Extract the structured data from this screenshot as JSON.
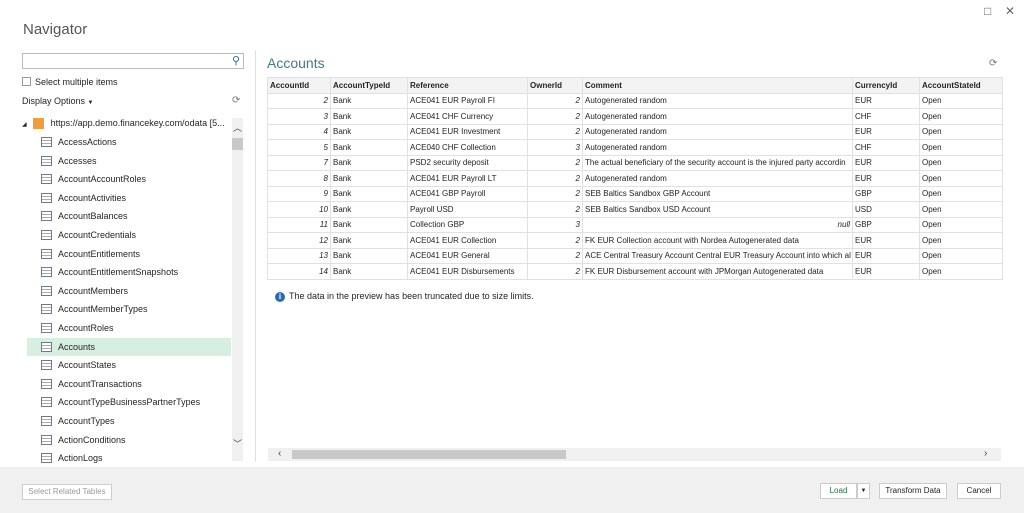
{
  "window": {
    "title": "Navigator",
    "maximize_icon": "□",
    "close_icon": "✕"
  },
  "left": {
    "search_placeholder": "",
    "select_multiple": "Select multiple items",
    "display_options": "Display Options",
    "root": "https://app.demo.financekey.com/odata [5...",
    "items": [
      "AccessActions",
      "Accesses",
      "AccountAccountRoles",
      "AccountActivities",
      "AccountBalances",
      "AccountCredentials",
      "AccountEntitlements",
      "AccountEntitlementSnapshots",
      "AccountMembers",
      "AccountMemberTypes",
      "AccountRoles",
      "Accounts",
      "AccountStates",
      "AccountTransactions",
      "AccountTypeBusinessPartnerTypes",
      "AccountTypes",
      "ActionConditions",
      "ActionLogs"
    ],
    "selected": "Accounts"
  },
  "preview": {
    "title": "Accounts",
    "columns": [
      "AccountId",
      "AccountTypeId",
      "Reference",
      "OwnerId",
      "Comment",
      "CurrencyId",
      "AccountStateId"
    ],
    "rows": [
      [
        "2",
        "Bank",
        "ACE041 EUR Payroll FI",
        "2",
        "Autogenerated random",
        "EUR",
        "Open"
      ],
      [
        "3",
        "Bank",
        "ACE041 CHF Currency",
        "2",
        "Autogenerated random",
        "CHF",
        "Open"
      ],
      [
        "4",
        "Bank",
        "ACE041 EUR Investment",
        "2",
        "Autogenerated random",
        "EUR",
        "Open"
      ],
      [
        "5",
        "Bank",
        "ACE040 CHF Collection",
        "3",
        "Autogenerated random",
        "CHF",
        "Open"
      ],
      [
        "7",
        "Bank",
        "PSD2 security deposit",
        "2",
        "The actual beneficiary of the security account is the injured party accordin",
        "EUR",
        "Open"
      ],
      [
        "8",
        "Bank",
        "ACE041 EUR Payroll LT",
        "2",
        "Autogenerated random",
        "EUR",
        "Open"
      ],
      [
        "9",
        "Bank",
        "ACE041 GBP Payroll",
        "2",
        "SEB Baltics Sandbox GBP Account",
        "GBP",
        "Open"
      ],
      [
        "10",
        "Bank",
        "Payroll USD",
        "2",
        "SEB Baltics Sandbox USD Account",
        "USD",
        "Open"
      ],
      [
        "11",
        "Bank",
        "Collection GBP",
        "3",
        "null",
        "GBP",
        "Open"
      ],
      [
        "12",
        "Bank",
        "ACE041 EUR Collection",
        "2",
        "FK EUR Collection account with Nordea Autogenerated data",
        "EUR",
        "Open"
      ],
      [
        "13",
        "Bank",
        "ACE041 EUR General",
        "2",
        "ACE Central Treasury Account Central EUR Treasury Account into which al",
        "EUR",
        "Open"
      ],
      [
        "14",
        "Bank",
        "ACE041 EUR Disbursements",
        "2",
        "FK EUR Disbursement account with JPMorgan Autogenerated data",
        "EUR",
        "Open"
      ]
    ],
    "info": "The data in the preview has been truncated due to size limits."
  },
  "footer": {
    "select_related": "Select Related Tables",
    "load": "Load",
    "transform": "Transform Data",
    "cancel": "Cancel"
  }
}
